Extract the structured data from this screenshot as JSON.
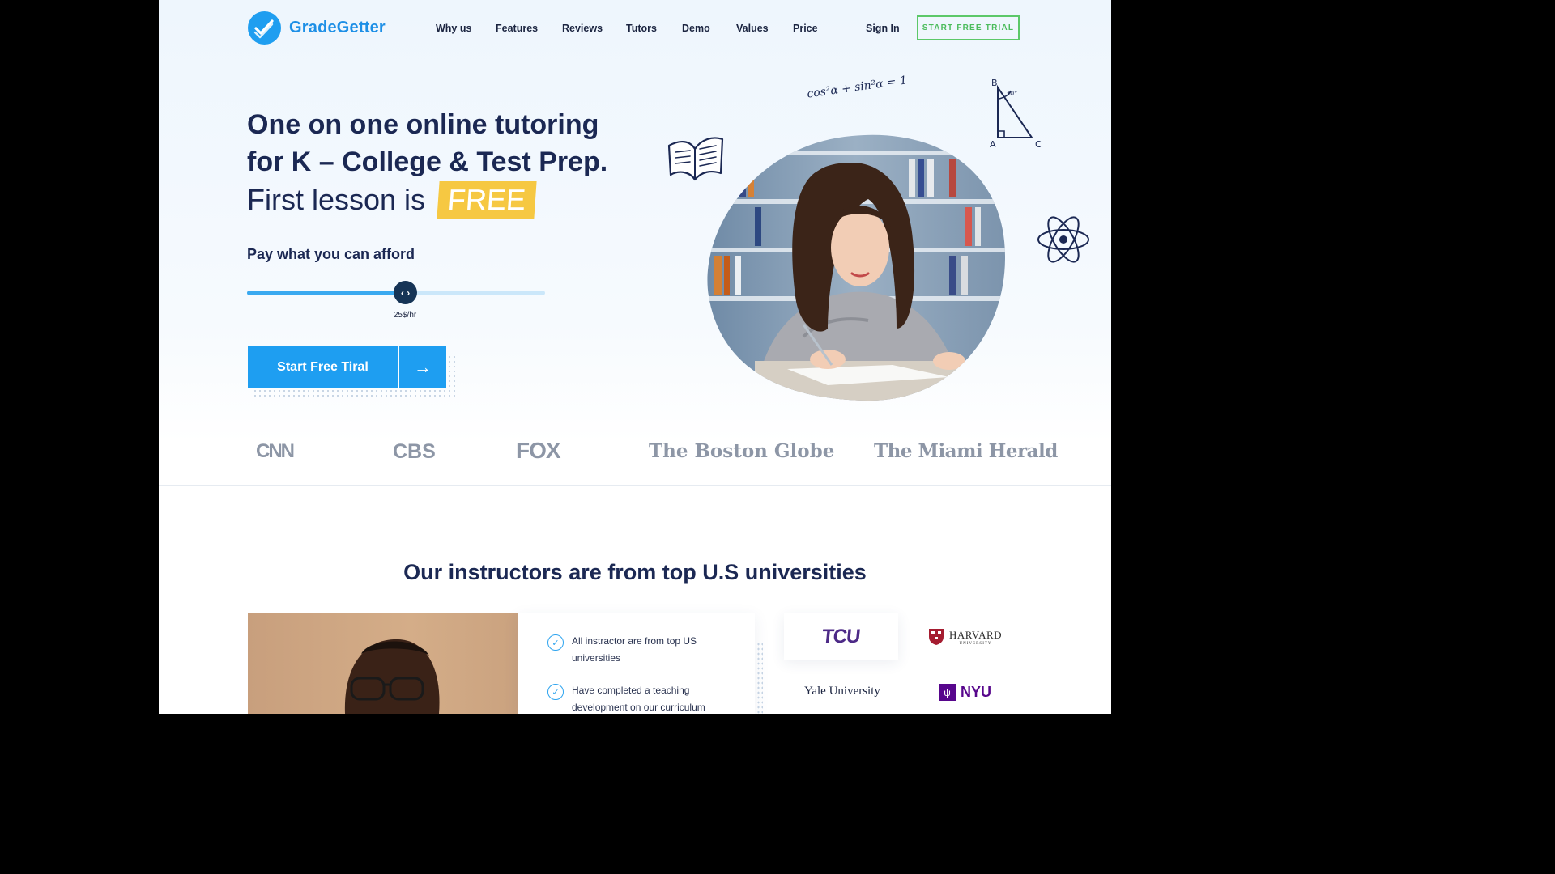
{
  "nav": {
    "brand": "GradeGetter",
    "links": [
      "Why us",
      "Features",
      "Reviews",
      "Tutors",
      "Demo",
      "Values",
      "Price"
    ],
    "sign_in": "Sign In",
    "cta": "START FREE TRIAL"
  },
  "hero": {
    "headline_line1": "One on one online tutoring",
    "headline_line2": "for K – College & Test Prep.",
    "subhead": "First lesson is",
    "free_badge": "FREE",
    "pay_label": "Pay what you can afford",
    "slider": {
      "value_text": "25$/hr",
      "fraction": 0.53
    },
    "cta_label": "Start Free Tiral"
  },
  "decorations": {
    "formula": "cos²α + sin²α = 1",
    "triangle_labels": [
      "B",
      "A",
      "C"
    ],
    "angle_label": "30°"
  },
  "press": [
    "CNN",
    "CBS",
    "FOX",
    "The Boston Globe",
    "The Miami Herald"
  ],
  "universities": {
    "heading": "Our instructors are from top U.S universities",
    "features": [
      "All instractor are from top US universities",
      "Have completed a teaching development on our curriculum"
    ],
    "logos": {
      "tcu": "TCU",
      "harvard": "HARVARD",
      "harvard_sub": "UNIVERSITY",
      "yale": "Yale University",
      "nyu": "NYU"
    }
  },
  "colors": {
    "accent": "#1e9ef1",
    "navy": "#1b2853",
    "free": "#f6c842",
    "trial_green": "#4cbc5d",
    "tcu": "#4d2a87",
    "nyu": "#57068c",
    "harvard": "#a51c30"
  }
}
